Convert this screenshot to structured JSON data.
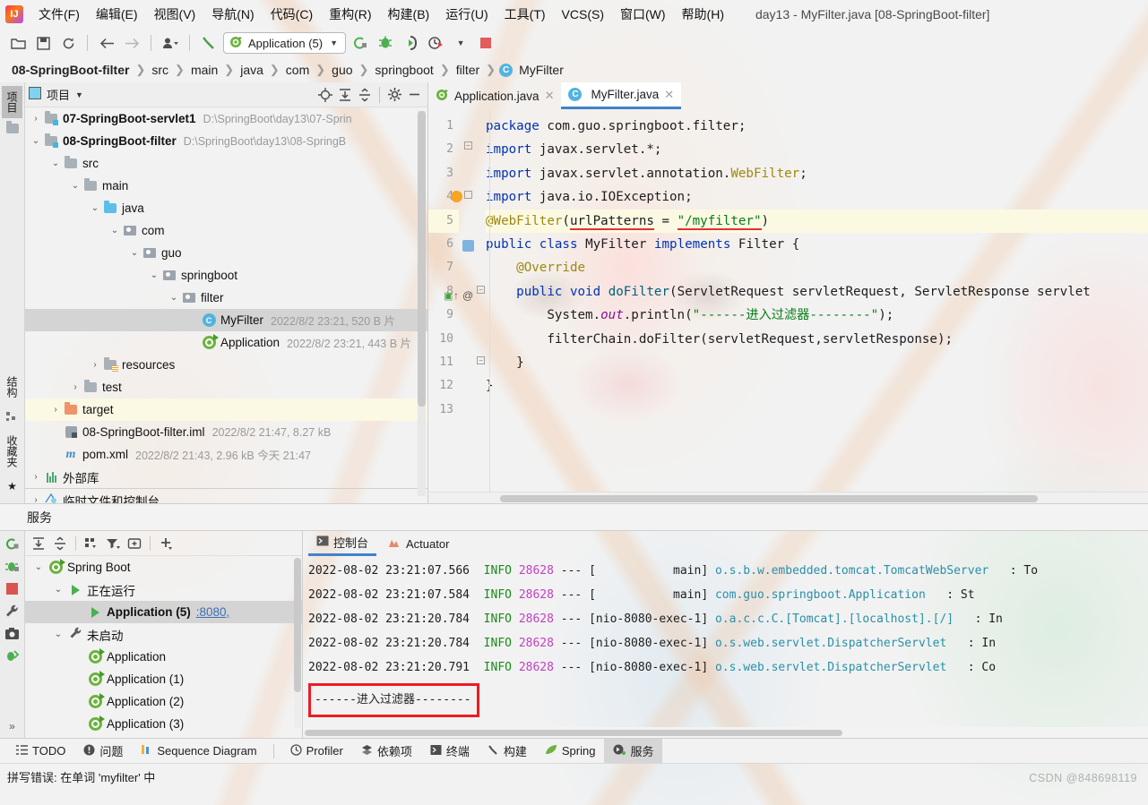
{
  "window": {
    "title": "day13 - MyFilter.java [08-SpringBoot-filter]",
    "logo": "intellij-idea-logo"
  },
  "menubar": {
    "items": [
      {
        "label": "文件(F)"
      },
      {
        "label": "编辑(E)"
      },
      {
        "label": "视图(V)"
      },
      {
        "label": "导航(N)"
      },
      {
        "label": "代码(C)"
      },
      {
        "label": "重构(R)"
      },
      {
        "label": "构建(B)"
      },
      {
        "label": "运行(U)"
      },
      {
        "label": "工具(T)"
      },
      {
        "label": "VCS(S)"
      },
      {
        "label": "窗口(W)"
      },
      {
        "label": "帮助(H)"
      }
    ]
  },
  "toolbar": {
    "open_label": "open-folder-icon",
    "save_label": "save-icon",
    "sync_label": "sync-icon",
    "back_label": "back-arrow-icon",
    "forward_label": "forward-arrow-icon",
    "profile_label": "user-profile-icon",
    "build_label": "build-hammer-icon",
    "run_config": "Application (5)",
    "run_label": "run-icon",
    "debug_label": "debug-icon",
    "coverage_label": "run-with-coverage-icon",
    "profiler_label": "profiler-icon",
    "stop_label": "stop-icon"
  },
  "breadcrumb": {
    "items": [
      "08-SpringBoot-filter",
      "src",
      "main",
      "java",
      "com",
      "guo",
      "springboot",
      "filter"
    ],
    "leaf": "MyFilter",
    "leaf_badge": "C"
  },
  "left_strip": {
    "project_label": "项目",
    "structure_label": "结构",
    "favorites_label": "收藏夹"
  },
  "project_panel": {
    "title": "项目",
    "buttons": [
      "locate-icon",
      "expand-all-icon",
      "collapse-all-icon",
      "settings-gear-icon",
      "hide-icon"
    ],
    "tree": [
      {
        "depth": 0,
        "arrow": "›",
        "icon": "module-folder",
        "label": "07-SpringBoot-servlet1",
        "bold": true,
        "meta": "D:\\SpringBoot\\day13\\07-Sprin"
      },
      {
        "depth": 0,
        "arrow": "⌄",
        "icon": "module-folder",
        "label": "08-SpringBoot-filter",
        "bold": true,
        "meta": "D:\\SpringBoot\\day13\\08-SpringB"
      },
      {
        "depth": 1,
        "arrow": "⌄",
        "icon": "folder",
        "label": "src",
        "bold": false,
        "meta": ""
      },
      {
        "depth": 2,
        "arrow": "⌄",
        "icon": "folder",
        "label": "main",
        "bold": false,
        "meta": ""
      },
      {
        "depth": 3,
        "arrow": "⌄",
        "icon": "folder-blue",
        "label": "java",
        "bold": false,
        "meta": ""
      },
      {
        "depth": 4,
        "arrow": "⌄",
        "icon": "package",
        "label": "com",
        "bold": false,
        "meta": ""
      },
      {
        "depth": 5,
        "arrow": "⌄",
        "icon": "package",
        "label": "guo",
        "bold": false,
        "meta": ""
      },
      {
        "depth": 6,
        "arrow": "⌄",
        "icon": "package",
        "label": "springboot",
        "bold": false,
        "meta": ""
      },
      {
        "depth": 7,
        "arrow": "⌄",
        "icon": "package",
        "label": "filter",
        "bold": false,
        "meta": ""
      },
      {
        "depth": 8,
        "arrow": "",
        "icon": "java-class",
        "label": "MyFilter",
        "bold": false,
        "meta": "2022/8/2 23:21, 520 B 片",
        "selected": true
      },
      {
        "depth": 8,
        "arrow": "",
        "icon": "spring-class",
        "label": "Application",
        "bold": false,
        "meta": "2022/8/2 23:21, 443 B 片"
      },
      {
        "depth": 3,
        "arrow": "›",
        "icon": "folder-resources",
        "label": "resources",
        "bold": false,
        "meta": ""
      },
      {
        "depth": 2,
        "arrow": "›",
        "icon": "folder",
        "label": "test",
        "bold": false,
        "meta": ""
      },
      {
        "depth": 1,
        "arrow": "›",
        "icon": "folder-orange",
        "label": "target",
        "bold": false,
        "meta": "",
        "target": true
      },
      {
        "depth": 1,
        "arrow": "",
        "icon": "iml-file",
        "label": "08-SpringBoot-filter.iml",
        "bold": false,
        "meta": "2022/8/2 21:47, 8.27 kB"
      },
      {
        "depth": 1,
        "arrow": "",
        "icon": "maven-file",
        "label": "pom.xml",
        "bold": false,
        "meta": "2022/8/2 21:43, 2.96 kB 今天 21:47"
      },
      {
        "depth": 0,
        "arrow": "›",
        "icon": "library",
        "label": "外部库",
        "bold": false,
        "meta": ""
      },
      {
        "depth": 0,
        "arrow": "›",
        "icon": "scratches",
        "label": "临时文件和控制台",
        "bold": false,
        "meta": ""
      }
    ]
  },
  "editor": {
    "tabs": [
      {
        "label": "Application.java",
        "icon": "spring-class",
        "active": false
      },
      {
        "label": "MyFilter.java",
        "icon": "java-class",
        "active": true
      }
    ],
    "line_numbers": [
      "1",
      "2",
      "3",
      "4",
      "5",
      "6",
      "7",
      "8",
      "9",
      "10",
      "11",
      "12",
      "13"
    ],
    "highlighted_line": 5,
    "code_lines": [
      "package com.guo.springboot.filter;",
      "import javax.servlet.*;",
      "import javax.servlet.annotation.WebFilter;",
      "import java.io.IOException;",
      "@WebFilter(urlPatterns = \"/myfilter\")",
      "public class MyFilter implements Filter {",
      "    @Override",
      "    public void doFilter(ServletRequest servletRequest, ServletResponse servlet",
      "        System.out.println(\"------进入过滤器--------\");",
      "        filterChain.doFilter(servletRequest,servletResponse);",
      "    }",
      "}",
      ""
    ],
    "spell_underline_text": "urlPatterns = \"/myfilter\""
  },
  "services_label": "服务",
  "bottom_strip": {
    "icons": [
      "rerun-icon",
      "rerun-failed-icon",
      "stop-icon",
      "settings-wrench-icon",
      "camera-icon",
      "export-icon",
      "more-icon"
    ]
  },
  "services_panel": {
    "toolbar": [
      "expand-all-icon",
      "collapse-all-icon",
      "group-icon",
      "filter-icon",
      "add-tab-icon",
      "add-icon"
    ],
    "tree": [
      {
        "depth": 0,
        "arrow": "⌄",
        "icon": "spring-boot",
        "label": "Spring Boot",
        "bold": false
      },
      {
        "depth": 1,
        "arrow": "⌄",
        "icon": "play",
        "label": "正在运行",
        "bold": false
      },
      {
        "depth": 2,
        "arrow": "",
        "icon": "play",
        "label": "Application (5)",
        "bold": true,
        "port": ":8080,",
        "selected": true
      },
      {
        "depth": 1,
        "arrow": "⌄",
        "icon": "wrench",
        "label": "未启动",
        "bold": false
      },
      {
        "depth": 2,
        "arrow": "",
        "icon": "spring-boot",
        "label": "Application",
        "bold": false
      },
      {
        "depth": 2,
        "arrow": "",
        "icon": "spring-boot",
        "label": "Application (1)",
        "bold": false
      },
      {
        "depth": 2,
        "arrow": "",
        "icon": "spring-boot",
        "label": "Application (2)",
        "bold": false
      },
      {
        "depth": 2,
        "arrow": "",
        "icon": "spring-boot",
        "label": "Application (3)",
        "bold": false
      }
    ]
  },
  "console": {
    "tabs": [
      {
        "label": "控制台",
        "icon": "console-icon",
        "active": true
      },
      {
        "label": "Actuator",
        "icon": "actuator-icon",
        "active": false
      }
    ],
    "log_lines": [
      {
        "date": "2022-08-02 23:21:07.566",
        "level": "INFO",
        "pid": "28628",
        "dash": "---",
        "thread": "[           main]",
        "logger": "o.s.b.w.embedded.tomcat.TomcatWebServer",
        "msg": ": To"
      },
      {
        "date": "2022-08-02 23:21:07.584",
        "level": "INFO",
        "pid": "28628",
        "dash": "---",
        "thread": "[           main]",
        "logger": "com.guo.springboot.Application",
        "msg": ": St"
      },
      {
        "date": "2022-08-02 23:21:20.784",
        "level": "INFO",
        "pid": "28628",
        "dash": "---",
        "thread": "[nio-8080-exec-1]",
        "logger": "o.a.c.c.C.[Tomcat].[localhost].[/]",
        "msg": ": In"
      },
      {
        "date": "2022-08-02 23:21:20.784",
        "level": "INFO",
        "pid": "28628",
        "dash": "---",
        "thread": "[nio-8080-exec-1]",
        "logger": "o.s.web.servlet.DispatcherServlet",
        "msg": ": In"
      },
      {
        "date": "2022-08-02 23:21:20.791",
        "level": "INFO",
        "pid": "28628",
        "dash": "---",
        "thread": "[nio-8080-exec-1]",
        "logger": "o.s.web.servlet.DispatcherServlet",
        "msg": ": Co"
      }
    ],
    "filter_output": "------进入过滤器--------",
    "highlight_color": "#ee1b24"
  },
  "toolwindow_bar": {
    "items": [
      {
        "label": "TODO",
        "icon": "todo-icon",
        "active": false
      },
      {
        "label": "问题",
        "icon": "problems-icon",
        "active": false
      },
      {
        "label": "Sequence Diagram",
        "icon": "sequence-diagram-icon",
        "active": false
      },
      {
        "label": "Profiler",
        "icon": "profiler-icon",
        "active": false
      },
      {
        "label": "依赖项",
        "icon": "dependencies-icon",
        "active": false
      },
      {
        "label": "终端",
        "icon": "terminal-icon",
        "active": false
      },
      {
        "label": "构建",
        "icon": "build-icon",
        "active": false
      },
      {
        "label": "Spring",
        "icon": "spring-icon",
        "active": false
      },
      {
        "label": "服务",
        "icon": "services-icon",
        "active": true
      }
    ]
  },
  "statusbar": {
    "message": "拼写错误: 在单词 'myfilter' 中"
  },
  "watermark": "CSDN @848698119"
}
